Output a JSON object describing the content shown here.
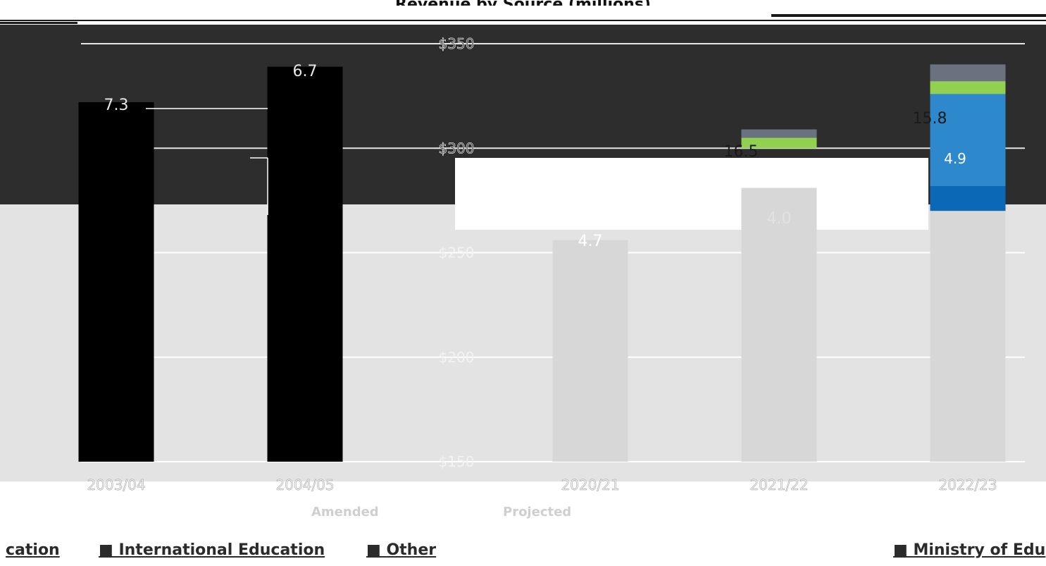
{
  "chart_data": {
    "type": "bar",
    "title": "Revenue by Source (millions)",
    "categories": [
      "2003/04",
      "2004/05",
      "2020/21",
      "2021/22",
      "2022/23"
    ],
    "y_ticks": [
      "$150",
      "$200",
      "$250",
      "$300",
      "$350"
    ],
    "ylim": [
      150,
      350
    ],
    "grid": true,
    "series": [
      {
        "name": "Ministry of Education",
        "values": [
          null,
          null,
          null,
          null,
          282
        ]
      },
      {
        "name": "International Education",
        "values": [
          null,
          null,
          null,
          null,
          4.9
        ]
      },
      {
        "name": "Other",
        "values": [
          null,
          null,
          null,
          null,
          15.8
        ]
      }
    ],
    "bar_totals": [
      322,
      339,
      256,
      281,
      340
    ],
    "data_labels": [
      "7.3",
      "6.7",
      "4.7",
      "4.0",
      "16.5",
      "15.8",
      "4.9"
    ],
    "column_labels": [
      "Amended",
      "Projected"
    ]
  },
  "legend": {
    "items": [
      "cation",
      "International Education",
      "Other",
      "Ministry of Edu"
    ]
  },
  "colors": {
    "dark_band": "#2d2d2d",
    "light_band": "#e3e3e3",
    "ministry": "#0a68b6",
    "international": "#2e88cc",
    "other": "#92d050",
    "grey_top": "#6a7280",
    "legacy_bar": "#000000",
    "gridline": "#ffffff"
  }
}
